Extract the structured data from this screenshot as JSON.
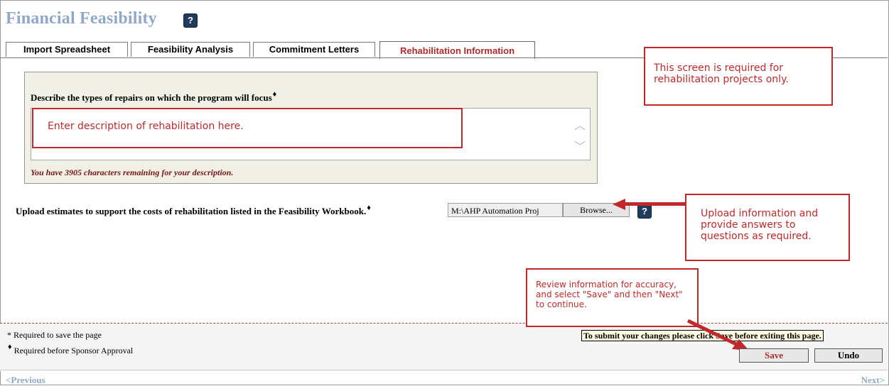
{
  "page": {
    "title": "Financial Feasibility",
    "help": "?"
  },
  "tabs": [
    {
      "label": "Import Spreadsheet"
    },
    {
      "label": "Feasibility Analysis"
    },
    {
      "label": "Commitment Letters"
    },
    {
      "label": "Rehabilitation Information",
      "active": true
    }
  ],
  "repairs": {
    "label": "Describe the types of repairs on which the program will focus",
    "required_marker": "♦",
    "placeholder": "Enter description of rehabilitation here.",
    "value": "",
    "chars_remaining": "You have 3905 characters remaining for your description."
  },
  "upload": {
    "label": "Upload estimates to support the costs of rehabilitation listed in the Feasibility Workbook.",
    "required_marker": "♦",
    "file_value": "M:\\AHP Automation Proj",
    "browse_label": "Browse...",
    "help": "?"
  },
  "callouts": {
    "required_screen": "This screen is required for rehabilitation projects only.",
    "upload_info": "Upload information and provide answers to questions as required.",
    "review_info": "Review information for accuracy, and select \"Save\" and then \"Next\" to continue."
  },
  "footer": {
    "required_save": "* Required to save the page",
    "required_sponsor_marker": "♦",
    "required_sponsor": "Required before Sponsor Approval",
    "submit_note": "To submit your changes please click Save before exiting this page.",
    "save_label": "Save",
    "undo_label": "Undo"
  },
  "nav": {
    "previous": "<Previous",
    "next": "Next>"
  },
  "colors": {
    "accent_red": "#c0282b",
    "title_blue": "#8fa8c8",
    "help_navy": "#1f3c5e"
  }
}
